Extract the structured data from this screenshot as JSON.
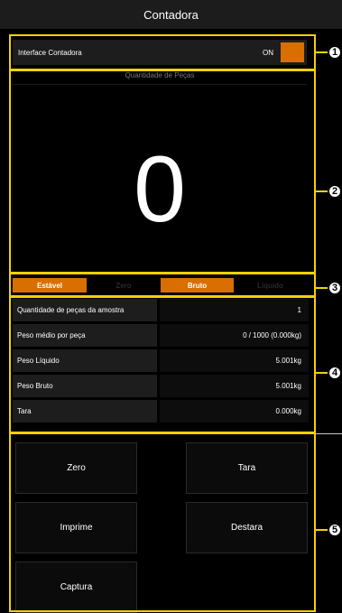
{
  "window": {
    "title": "Contadora"
  },
  "interface": {
    "label": "Interface Contadora",
    "toggle_state": "ON",
    "toggle_color": "#d96f00"
  },
  "display": {
    "header": "Quantidade de Peças",
    "count": "0"
  },
  "status_bar": [
    {
      "label": "Estável",
      "active": true
    },
    {
      "label": "Zero",
      "active": false
    },
    {
      "label": "Bruto",
      "active": true
    },
    {
      "label": "Líquido",
      "active": false
    }
  ],
  "table": [
    {
      "label": "Quantidade de peças da amostra",
      "value": "1"
    },
    {
      "label": "Peso médio por peça",
      "value": "0 / 1000 (0.000kg)"
    },
    {
      "label": "Peso Líquido",
      "value": "5.001kg"
    },
    {
      "label": "Peso Bruto",
      "value": "5.001kg"
    },
    {
      "label": "Tara",
      "value": "0.000kg"
    }
  ],
  "buttons": {
    "zero": "Zero",
    "tara": "Tara",
    "imprime": "Imprime",
    "destara": "Destara",
    "captura": "Captura"
  },
  "callouts": [
    "1",
    "2",
    "3",
    "4",
    "5"
  ],
  "colors": {
    "highlight": "#f0d200",
    "accent": "#d96f00"
  }
}
